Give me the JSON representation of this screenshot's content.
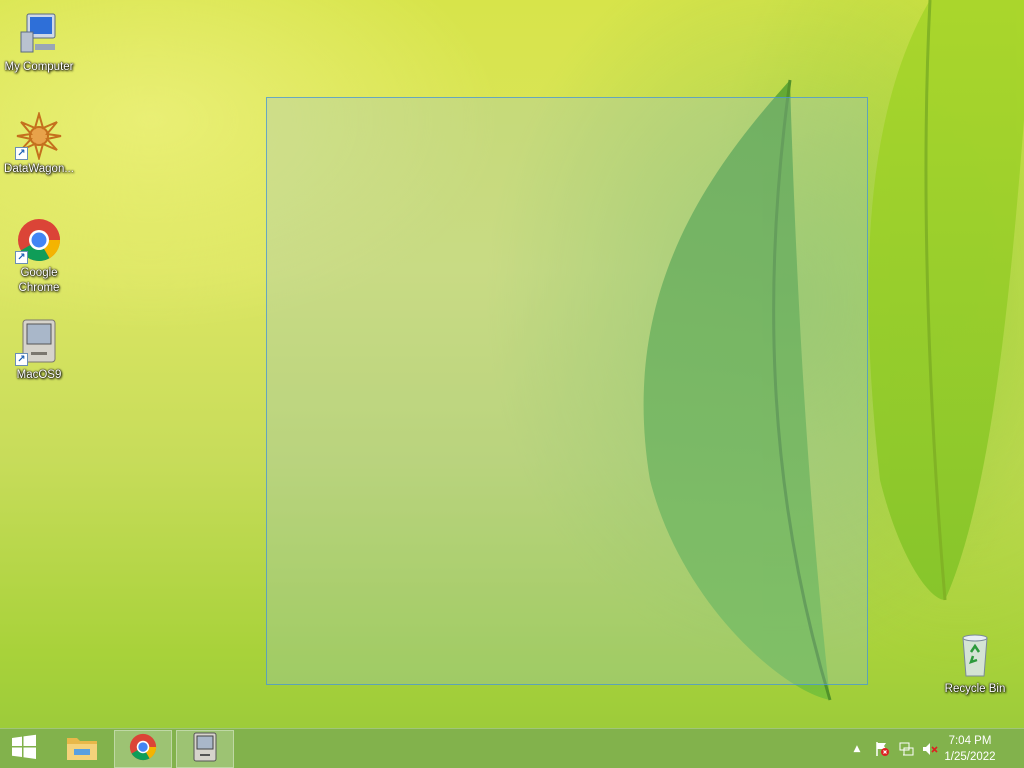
{
  "desktop": {
    "icons": [
      {
        "label": "My Computer",
        "icon": "computer-icon"
      },
      {
        "label": "DataWagon...",
        "icon": "datawagon-icon"
      },
      {
        "label": "Google Chrome",
        "icon": "chrome-icon"
      },
      {
        "label": "MacOS9",
        "icon": "classic-mac-icon"
      },
      {
        "label": "Recycle Bin",
        "icon": "recycle-bin-icon"
      }
    ],
    "shortcut_glyph": "↗"
  },
  "taskbar": {
    "pinned": [
      {
        "name": "start-button",
        "icon": "windows-logo-icon"
      },
      {
        "name": "file-explorer-button",
        "icon": "folder-icon"
      },
      {
        "name": "chrome-taskbar-button",
        "icon": "chrome-icon"
      },
      {
        "name": "macos9-taskbar-button",
        "icon": "classic-mac-icon"
      }
    ],
    "tray": {
      "overflow_glyph": "▲",
      "icons": [
        "action-center-flag-icon",
        "network-icon",
        "volume-muted-icon"
      ]
    },
    "clock": {
      "time": "7:04 PM",
      "date": "1/25/2022"
    }
  },
  "colors": {
    "taskbar": "#80b04e",
    "selection_border": "#4696d2",
    "leaf": "#6cb83a"
  }
}
